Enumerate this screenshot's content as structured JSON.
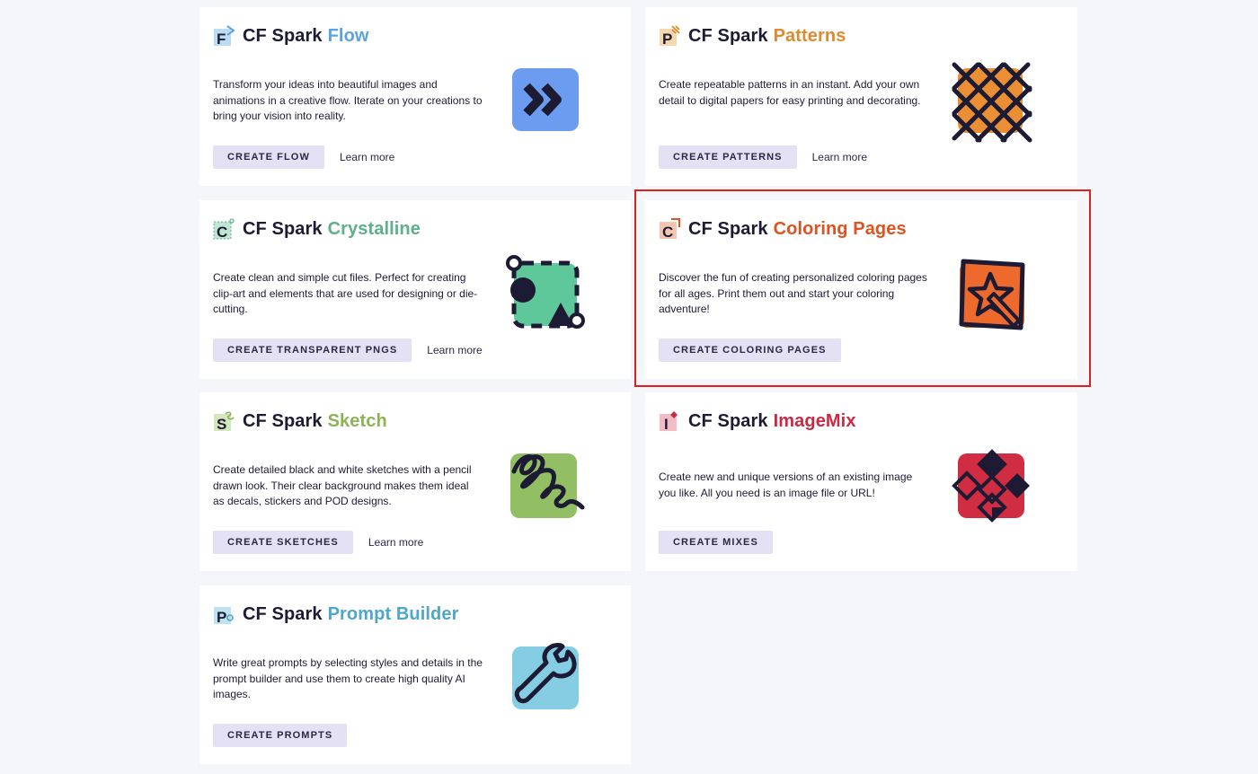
{
  "brand": "CF Spark",
  "cards": [
    {
      "product": "Flow",
      "accent": "#5ba3e0",
      "logo_letter": "F",
      "illustration": "double-chevron-right-icon",
      "description": "Transform your ideas into beautiful images and animations in a creative flow. Iterate on your creations to bring your vision into reality.",
      "cta": "CREATE FLOW",
      "learn_more": "Learn more"
    },
    {
      "product": "Patterns",
      "accent": "#e0892f",
      "logo_letter": "P",
      "illustration": "crosshatch-pattern-icon",
      "description": "Create repeatable patterns in an instant. Add your own detail to digital papers for easy printing and decorating.",
      "cta": "CREATE PATTERNS",
      "learn_more": "Learn more"
    },
    {
      "product": "Crystalline",
      "accent": "#5db08b",
      "logo_letter": "C",
      "illustration": "shapes-selection-icon",
      "description": "Create clean and simple cut files. Perfect for creating clip-art and elements that are used for designing or die-cutting.",
      "cta": "CREATE TRANSPARENT PNGS",
      "learn_more": "Learn more"
    },
    {
      "product": "Coloring Pages",
      "accent": "#e0521f",
      "logo_letter": "C",
      "illustration": "star-pencil-icon",
      "description": "Discover the fun of creating personalized coloring pages for all ages. Print them out and start your coloring adventure!",
      "cta": "CREATE COLORING PAGES",
      "learn_more": ""
    },
    {
      "product": "Sketch",
      "accent": "#8cb356",
      "logo_letter": "S",
      "illustration": "squiggle-icon",
      "description": "Create detailed black and white sketches with a pencil drawn look. Their clear background makes them ideal as decals, stickers and POD designs.",
      "cta": "CREATE SKETCHES",
      "learn_more": "Learn more"
    },
    {
      "product": "ImageMix",
      "accent": "#cc2a44",
      "logo_letter": "I",
      "illustration": "diamond-grid-icon",
      "description": "Create new and unique versions of an existing image you like. All you need is an image file or URL!",
      "cta": "CREATE MIXES",
      "learn_more": ""
    },
    {
      "product": "Prompt Builder",
      "accent": "#4fa6c8",
      "logo_letter": "P",
      "illustration": "wrench-icon",
      "description": "Write great prompts by selecting styles and details in the prompt builder and use them to create high quality AI images.",
      "cta": "CREATE PROMPTS",
      "learn_more": ""
    }
  ]
}
